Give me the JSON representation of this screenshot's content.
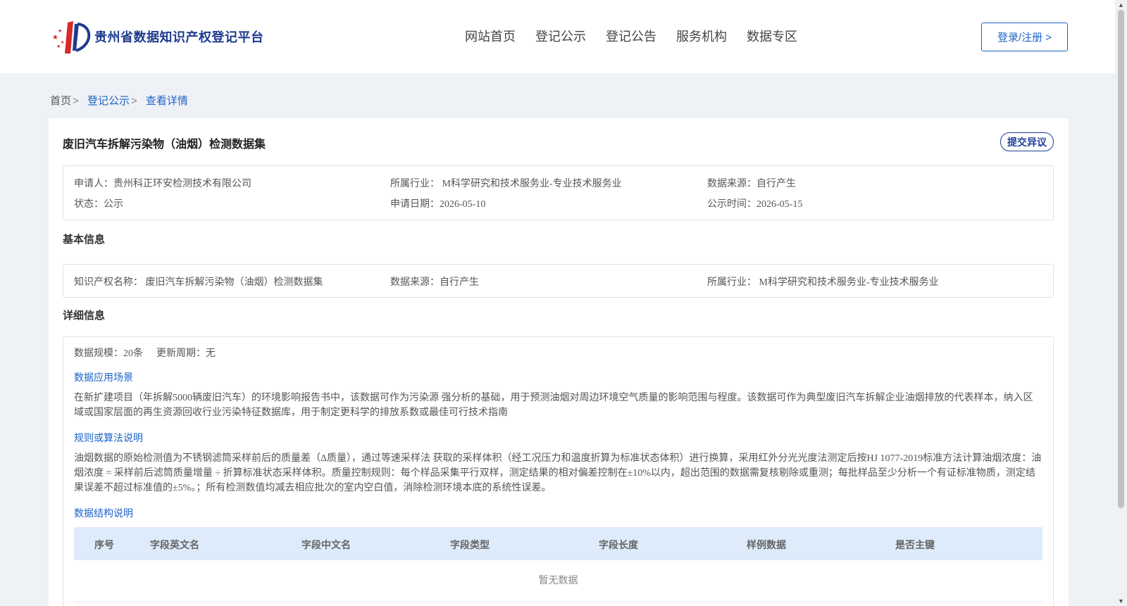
{
  "header": {
    "site_title": "贵州省数据知识产权登记平台",
    "nav": [
      "网站首页",
      "登记公示",
      "登记公告",
      "服务机构",
      "数据专区"
    ],
    "login_label": "登录/注册 >"
  },
  "breadcrumb": {
    "home": "首页",
    "level1": "登记公示",
    "level2": "查看详情",
    "separator": ">"
  },
  "record": {
    "title": "废旧汽车拆解污染物（油烟）检测数据集",
    "objection_label": "提交异议",
    "applicant": "申请人：贵州科正环安检测技术有限公司",
    "industry": "所属行业： M科学研究和技术服务业-专业技术服务业",
    "source": "数据来源：自行产生",
    "status": "状态：公示",
    "apply_date": "申请日期：2026-05-10",
    "publish_date": "公示时间：2026-05-15"
  },
  "basic": {
    "heading": "基本信息",
    "ip_name": "知识产权名称： 废旧汽车拆解污染物（油烟）检测数据集",
    "source": "数据来源：自行产生",
    "industry": "所属行业： M科学研究和技术服务业-专业技术服务业"
  },
  "detail": {
    "heading": "详细信息",
    "scale": "数据规模：20条",
    "cycle": "更新周期：无",
    "scenario_title": "数据应用场景",
    "scenario_text": "在新扩建项目（年拆解5000辆废旧汽车）的环境影响报告书中，该数据可作为污染源 强分析的基础，用于预测油烟对周边环境空气质量的影响范围与程度。该数据可作为典型废旧汽车拆解企业油烟排放的代表样本，纳入区域或国家层面的再生资源回收行业污染特征数据库，用于制定更科学的排放系数或最佳可行技术指南",
    "algo_title": "规则或算法说明",
    "algo_text": "油烟数据的原始检测值为不锈钢滤筒采样前后的质量差（Δ质量），通过等速采样法 获取的采样体积（经工况压力和温度折算为标准状态体积）进行换算，采用红外分光光度法测定后按HJ 1077-2019标准方法计算油烟浓度：油烟浓度 = 采样前后滤筒质量增量 ÷ 折算标准状态采样体积。质量控制规则：每个样品采集平行双样，测定结果的相对偏差控制在±10%以内，超出范围的数据需复核剔除或重测；每批样品至少分析一个有证标准物质，测定结果误差不超过标准值的±5%。；所有检测数值均减去相应批次的室内空白值，消除检测环境本底的系统性误差。",
    "structure_title": "数据结构说明",
    "table_headers": [
      "序号",
      "字段英文名",
      "字段中文名",
      "字段类型",
      "字段长度",
      "样例数据",
      "是否主键"
    ],
    "empty_text": "暂无数据"
  },
  "colors": {
    "accent": "#1e63c8",
    "brand": "#1f3b8f",
    "table_header_bg": "#deebfb",
    "page_bg": "#eef1f5"
  }
}
